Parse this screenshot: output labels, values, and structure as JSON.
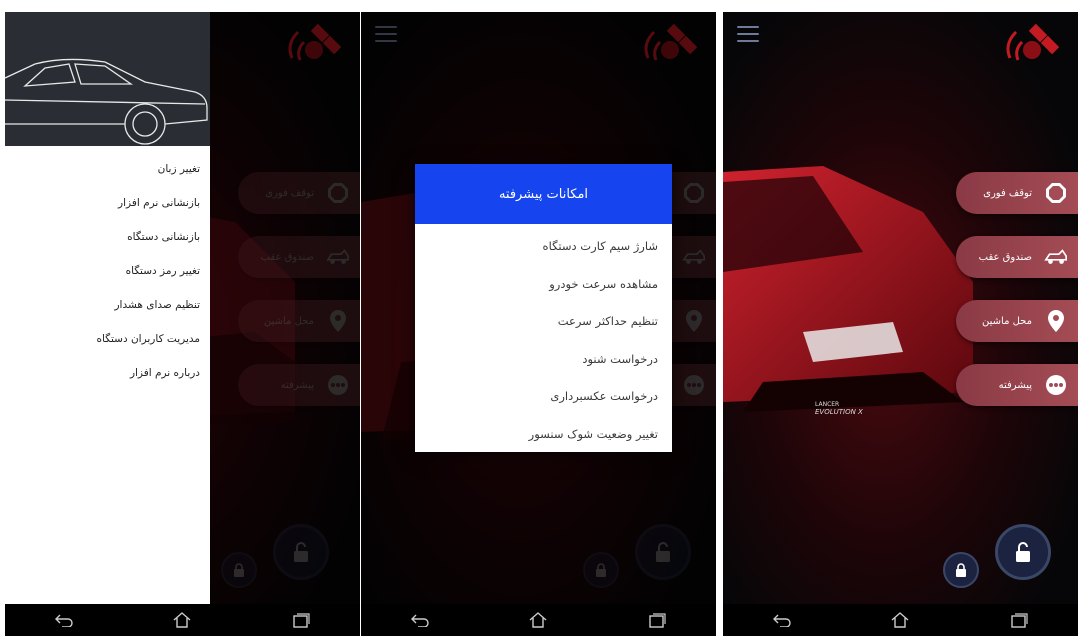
{
  "icons": {
    "satellite": "satellite-signal-icon",
    "hamburger": "menu-icon",
    "stop": "emergency-stop-icon",
    "trunk": "car-trunk-icon",
    "location": "location-pin-icon",
    "more": "more-dots-icon",
    "lock": "lock-icon",
    "unlock": "unlock-icon",
    "back": "back-icon",
    "home": "home-icon",
    "recents": "recents-icon"
  },
  "actions": {
    "emergency_stop": "توقف فوری",
    "trunk": "صندوق عقب",
    "car_location": "محل ماشین",
    "advanced": "پیشرفته"
  },
  "drawer": {
    "items": [
      "تغییر زبان",
      "بازنشانی نرم افزار",
      "بازنشانی دستگاه",
      "تغییر رمز دستگاه",
      "تنظیم صدای هشدار",
      "مدیریت کاربران دستگاه",
      "درباره نرم افزار"
    ]
  },
  "dialog": {
    "title": "امکانات پیشرفته",
    "items": [
      "شارژ سیم کارت دستگاه",
      "مشاهده سرعت خودرو",
      "تنظیم حداکثر سرعت",
      "درخواست شنود",
      "درخواست عکسبرداری",
      "تغییر وضعیت شوک سنسور"
    ]
  },
  "car_badge": {
    "line1": "LANCER",
    "line2": "EVOLUTION X"
  },
  "colors": {
    "dialog_header": "#1644ee",
    "action_button": "#a44c55",
    "lock_button": "#1b2340",
    "navbar": "#000000"
  }
}
